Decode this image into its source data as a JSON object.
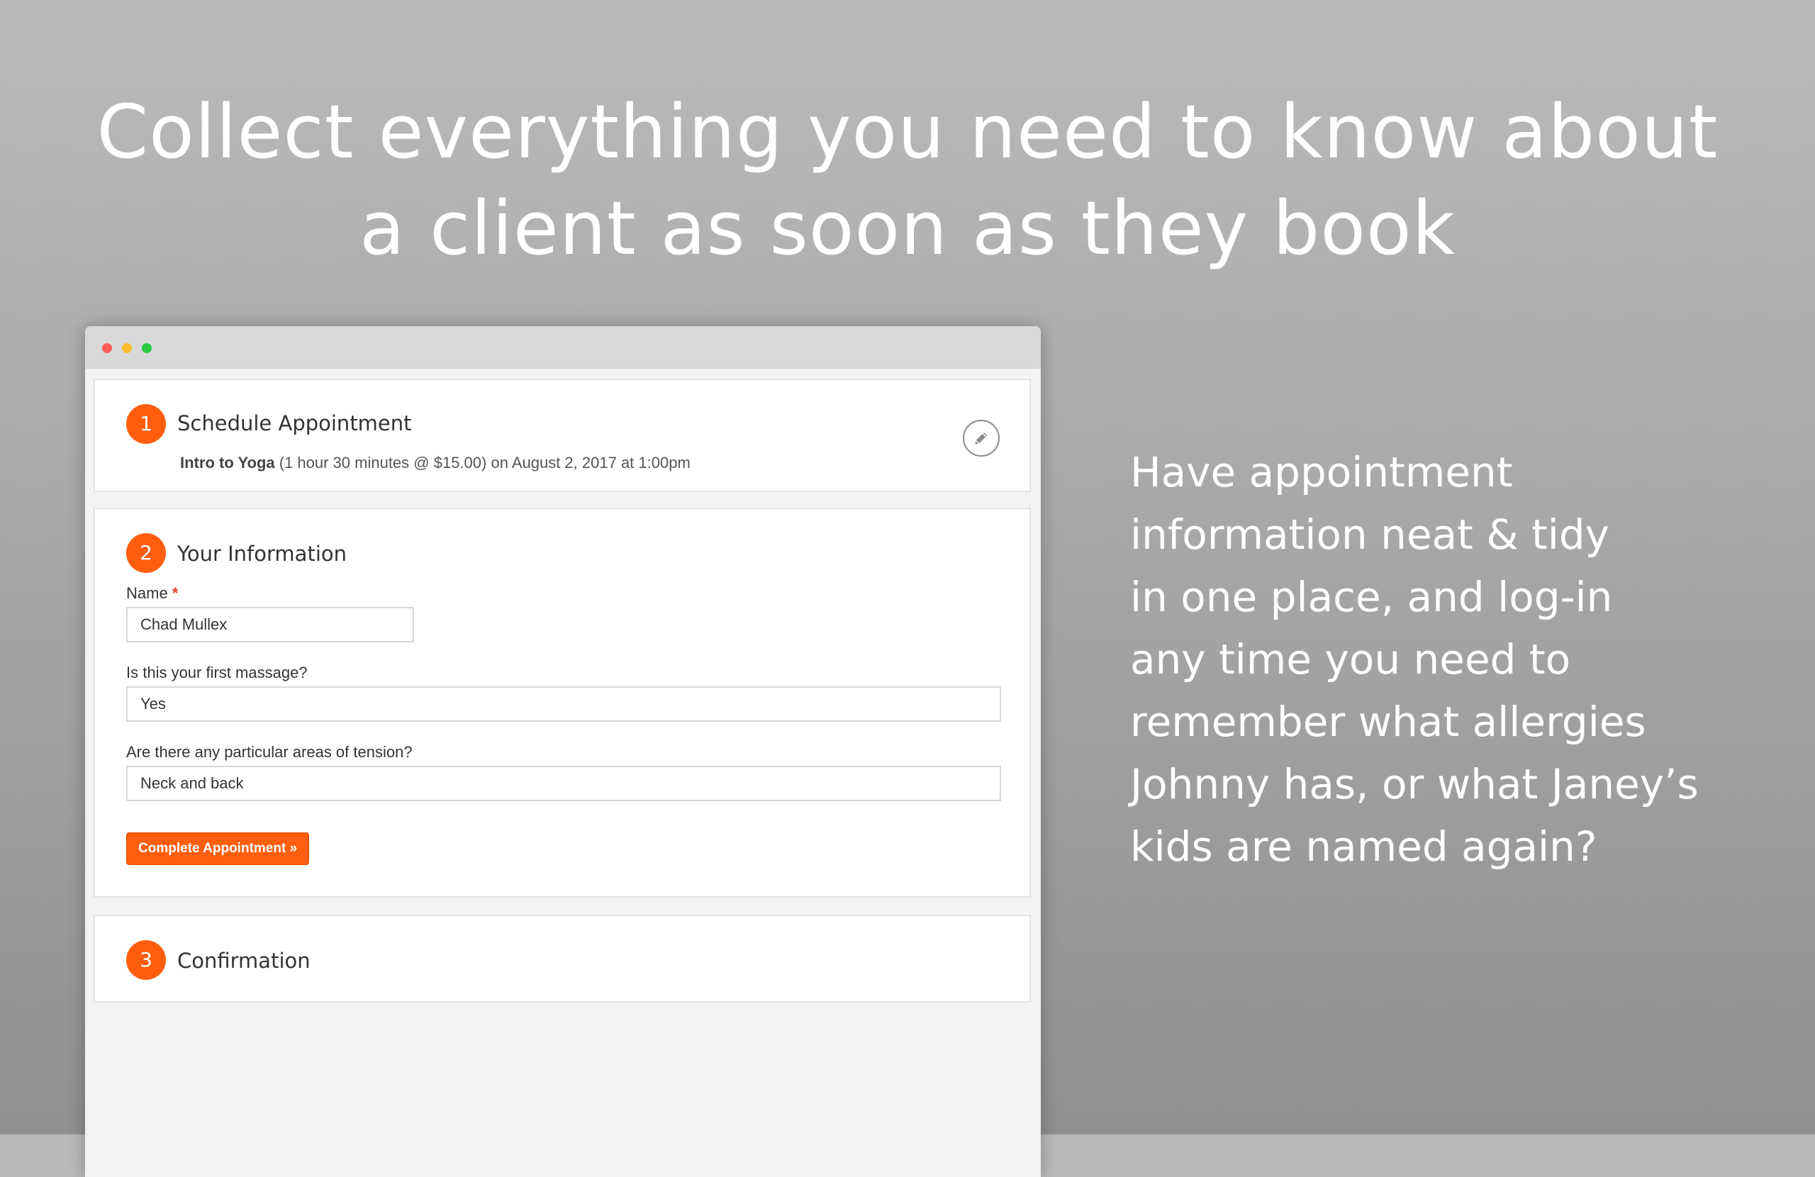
{
  "headline": {
    "line1": "Collect everything you need to know about",
    "line2": "a client as soon as they book"
  },
  "window": {
    "controls": {
      "close_color": "#fc5f57",
      "minimize_color": "#fdbc2e",
      "zoom_color": "#28c840"
    }
  },
  "steps": {
    "schedule": {
      "number": "1",
      "title": "Schedule Appointment",
      "service": "Intro to Yoga",
      "details": " (1 hour 30 minutes @ $15.00) on August 2, 2017 at 1:00pm",
      "edit_icon": "pencil-icon"
    },
    "information": {
      "number": "2",
      "title": "Your Information",
      "fields": {
        "name": {
          "label": "Name",
          "required_marker": "*",
          "value": "Chad Mullex"
        },
        "first_massage": {
          "label": "Is this your first massage?",
          "value": "Yes"
        },
        "tension": {
          "label": "Are there any particular areas of tension?",
          "value": "Neck and back"
        }
      },
      "submit_label": "Complete Appointment »"
    },
    "confirmation": {
      "number": "3",
      "title": "Confirmation"
    }
  },
  "side_text": {
    "lines": [
      "Have appointment",
      "information neat & tidy",
      "in one place, and log-in",
      "any time you need to",
      "remember what allergies",
      "Johnny has, or what Janey’s",
      "kids are named again?"
    ]
  },
  "colors": {
    "accent": "#ff5e0e",
    "required": "#e8412c"
  }
}
